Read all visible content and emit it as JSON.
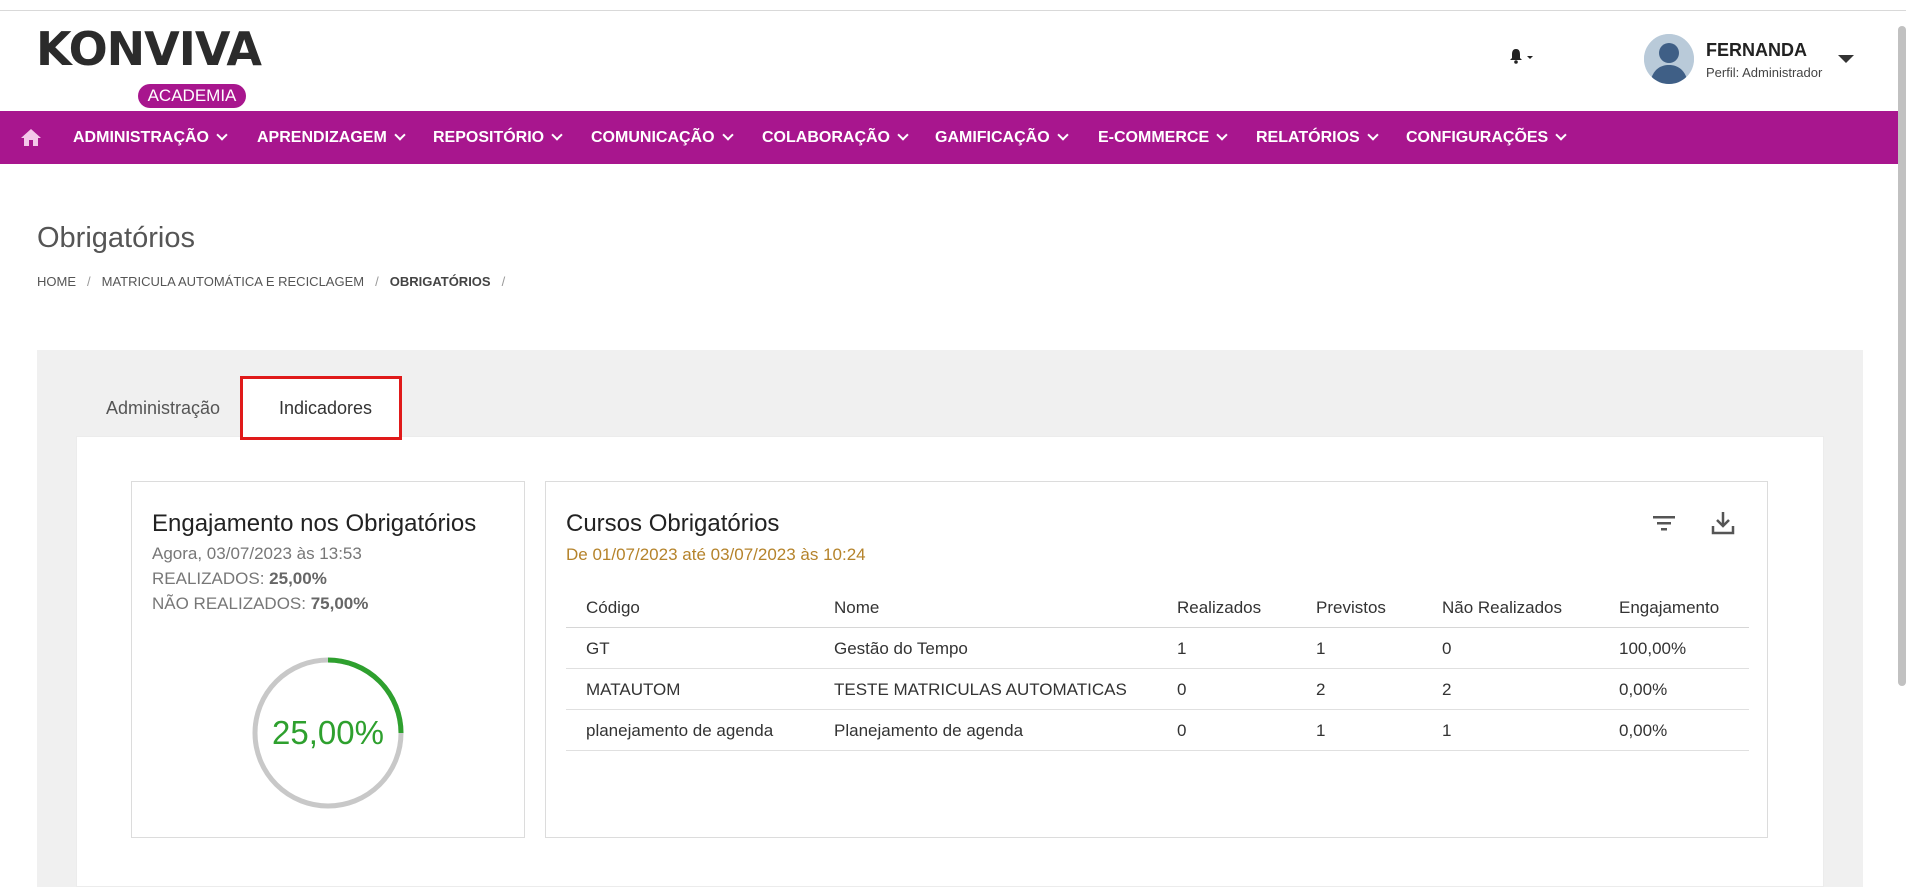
{
  "header": {
    "logo_text": "KONVIVA",
    "logo_badge": "ACADEMIA",
    "user_name": "FERNANDA",
    "user_profile": "Perfil: Administrador"
  },
  "nav": {
    "items": [
      {
        "label": "ADMINISTRAÇÃO"
      },
      {
        "label": "APRENDIZAGEM"
      },
      {
        "label": "REPOSITÓRIO"
      },
      {
        "label": "COMUNICAÇÃO"
      },
      {
        "label": "COLABORAÇÃO"
      },
      {
        "label": "GAMIFICAÇÃO"
      },
      {
        "label": "E-COMMERCE"
      },
      {
        "label": "RELATÓRIOS"
      },
      {
        "label": "CONFIGURAÇÕES"
      }
    ]
  },
  "page": {
    "title": "Obrigatórios",
    "breadcrumb": [
      "HOME",
      "MATRICULA AUTOMÁTICA E RECICLAGEM",
      "OBRIGATÓRIOS"
    ]
  },
  "tabs": [
    {
      "label": "Administração",
      "active": false
    },
    {
      "label": "Indicadores",
      "active": true
    }
  ],
  "engajamento": {
    "title": "Engajamento nos Obrigatórios",
    "timestamp": "Agora, 03/07/2023 às 13:53",
    "realizados_label": "REALIZADOS:",
    "realizados_value": "25,00%",
    "nao_realizados_label": "NÃO REALIZADOS:",
    "nao_realizados_value": "75,00%",
    "gauge_label": "25,00%",
    "gauge_fraction": 0.25,
    "gauge_color": "#2ea02e",
    "gauge_track_color": "#c8c8c8"
  },
  "cursos": {
    "title": "Cursos Obrigatórios",
    "period": "De 01/07/2023 até 03/07/2023 às 10:24",
    "icons": [
      "filter-icon",
      "download-icon"
    ],
    "columns": [
      "Código",
      "Nome",
      "Realizados",
      "Previstos",
      "Não Realizados",
      "Engajamento"
    ],
    "rows": [
      [
        "GT",
        "Gestão do Tempo",
        "1",
        "1",
        "0",
        "100,00%"
      ],
      [
        "MATAUTOM",
        "TESTE MATRICULAS AUTOMATICAS",
        "0",
        "2",
        "2",
        "0,00%"
      ],
      [
        "planejamento de agenda",
        "Planejamento de agenda",
        "0",
        "1",
        "1",
        "0,00%"
      ]
    ]
  },
  "colors": {
    "brand": "#a8168e",
    "accent_orange": "#b5832b",
    "highlight_red": "#e01a1a"
  }
}
